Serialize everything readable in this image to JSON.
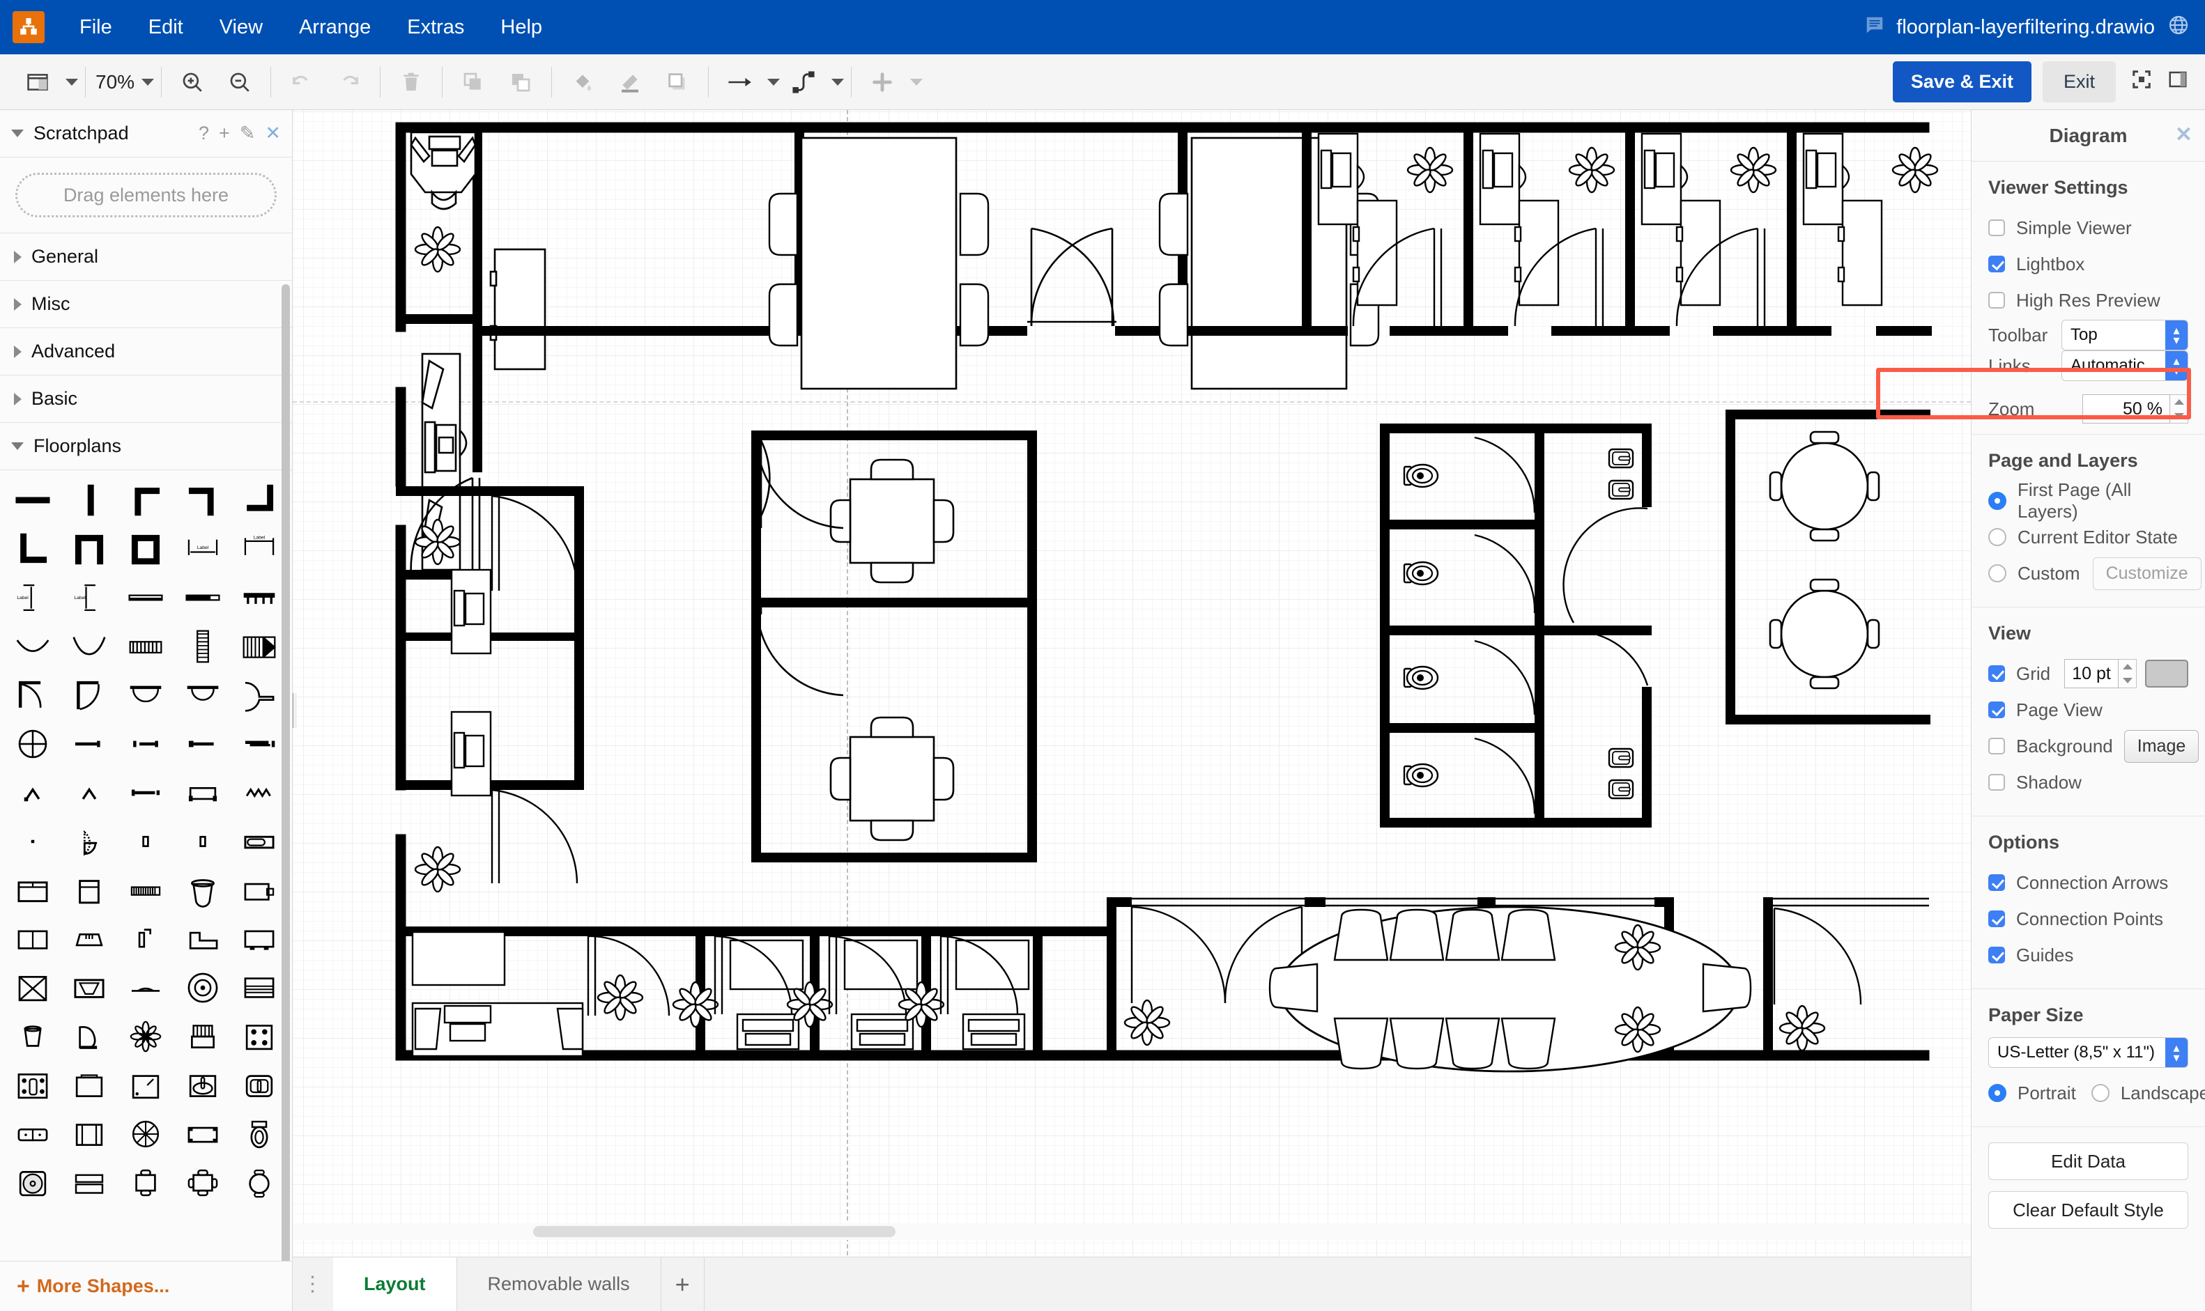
{
  "app": {
    "logo_icon": "drawio-logo-icon",
    "menu_items": [
      "File",
      "Edit",
      "View",
      "Arrange",
      "Extras",
      "Help"
    ],
    "comment_icon": "comment-icon",
    "file_title": "floorplan-layerfiltering.drawio",
    "globe_icon": "globe-icon"
  },
  "toolbar": {
    "view_layout_icon": "view-layout-icon",
    "zoom_level": "70%",
    "zoom_in_icon": "zoom-in-icon",
    "zoom_out_icon": "zoom-out-icon",
    "undo_icon": "undo-icon",
    "redo_icon": "redo-icon",
    "delete_icon": "trash-icon",
    "to_front_icon": "bring-to-front-icon",
    "to_back_icon": "send-to-back-icon",
    "fill_color_icon": "fill-color-icon",
    "line_color_icon": "line-color-icon",
    "shadow_icon": "shadow-icon",
    "connection_icon": "connection-arrow-icon",
    "waypoints_icon": "waypoints-icon",
    "insert_icon": "insert-plus-icon",
    "save_exit_label": "Save & Exit",
    "exit_label": "Exit",
    "fullscreen_icon": "fullscreen-icon",
    "format_panel_icon": "format-panel-icon"
  },
  "sidebar": {
    "scratchpad": {
      "label": "Scratchpad",
      "help_icon": "question-mark-icon",
      "add_icon": "plus-icon",
      "edit_icon": "pencil-icon",
      "close_icon": "close-icon",
      "drop_placeholder": "Drag elements here"
    },
    "sections": [
      {
        "label": "General",
        "expanded": false
      },
      {
        "label": "Misc",
        "expanded": false
      },
      {
        "label": "Advanced",
        "expanded": false
      },
      {
        "label": "Basic",
        "expanded": false
      },
      {
        "label": "Floorplans",
        "expanded": true
      }
    ],
    "more_shapes_label": "More Shapes...",
    "shape_names": [
      "wall-horizontal",
      "wall-vertical",
      "wall-corner-tl",
      "wall-corner-tr",
      "wall-corner-br",
      "wall-corner-bl",
      "wall-u",
      "wall-square",
      "dimension-horizontal",
      "dimension-double",
      "dimension-vertical",
      "dimension-vertical-alt",
      "wall-double-line",
      "wall-partial",
      "railing",
      "curve-shallow",
      "curve-deep",
      "stairs-straight",
      "stairs-narrow",
      "stairs-landing",
      "door-arc-left",
      "door-arc-right",
      "door-double",
      "door-double-alt",
      "door-sliding",
      "window-round",
      "wall-segment-a",
      "wall-segment-b",
      "wall-segment-c",
      "corner-joint",
      "wall-segment-d",
      "counter",
      "zigzag-stair",
      "door-quarter",
      "post-small",
      "sofa-single",
      "bed-double",
      "bed-single",
      "keyboard",
      "lamp-floor",
      "desk-workstation",
      "table-split",
      "range-hood",
      "sink-corner",
      "counter-corner",
      "tv-flat",
      "table-square-x",
      "projector-screen",
      "rug-flat",
      "fan-ceiling",
      "piano-upright",
      "trash-bin",
      "piano-grand",
      "plant-flower",
      "armchair",
      "stove-4-burner",
      "stove-range",
      "washer",
      "shower-square",
      "sink-round",
      "sink-rect",
      "double-sink",
      "bed-made",
      "fan-round",
      "table-rect",
      "toilet",
      "washing-machine",
      "printer-copier",
      "chair-table-2",
      "chair-table-4",
      "chair-round",
      "bench-2",
      "bench-3",
      "stool-set",
      "table-long"
    ]
  },
  "canvas": {
    "floorplan_name": "office-floorplan",
    "page_break_guides": true
  },
  "tabs": {
    "menu_dots_icon": "kebab-menu-icon",
    "items": [
      {
        "label": "Layout",
        "active": true
      },
      {
        "label": "Removable walls",
        "active": false
      }
    ],
    "add_label": "+"
  },
  "right_panel": {
    "title": "Diagram",
    "close_icon": "close-icon",
    "viewer_settings": {
      "title": "Viewer Settings",
      "checkboxes": [
        {
          "label": "Simple Viewer",
          "checked": false
        },
        {
          "label": "Lightbox",
          "checked": true
        },
        {
          "label": "High Res Preview",
          "checked": false
        }
      ],
      "toolbar_label": "Toolbar",
      "toolbar_value": "Top",
      "links_label": "Links",
      "links_value": "Automatic",
      "zoom_label": "Zoom",
      "zoom_value": "50 %"
    },
    "page_and_layers": {
      "title": "Page and Layers",
      "radios": [
        {
          "label": "First Page (All Layers)",
          "selected": true
        },
        {
          "label": "Current Editor State",
          "selected": false
        },
        {
          "label": "Custom",
          "selected": false
        }
      ],
      "customize_label": "Customize"
    },
    "view": {
      "title": "View",
      "grid_label": "Grid",
      "grid_checked": true,
      "grid_size": "10 pt",
      "grid_color_swatch": "#c9c9c9",
      "page_view_label": "Page View",
      "page_view_checked": true,
      "background_label": "Background",
      "background_checked": false,
      "background_button": "Image",
      "shadow_label": "Shadow",
      "shadow_checked": false
    },
    "options": {
      "title": "Options",
      "checkboxes": [
        {
          "label": "Connection Arrows",
          "checked": true
        },
        {
          "label": "Connection Points",
          "checked": true
        },
        {
          "label": "Guides",
          "checked": true
        }
      ]
    },
    "paper_size": {
      "title": "Paper Size",
      "value": "US-Letter (8,5\" x 11\")",
      "orientation": [
        {
          "label": "Portrait",
          "selected": true
        },
        {
          "label": "Landscape",
          "selected": false
        }
      ]
    },
    "actions": {
      "edit_data": "Edit Data",
      "clear_default_style": "Clear Default Style"
    },
    "highlight": {
      "name": "zoom-field-highlight",
      "color": "#fa5c48"
    }
  },
  "colors": {
    "menubar_blue": "#0050b3",
    "accent_blue": "#1257c4",
    "checkbox_blue": "#3d7ff4",
    "logo_orange": "#e8710a",
    "active_tab_green": "#0a7d33",
    "more_shapes_orange": "#d2691e",
    "highlight_red": "#fa5c48"
  }
}
